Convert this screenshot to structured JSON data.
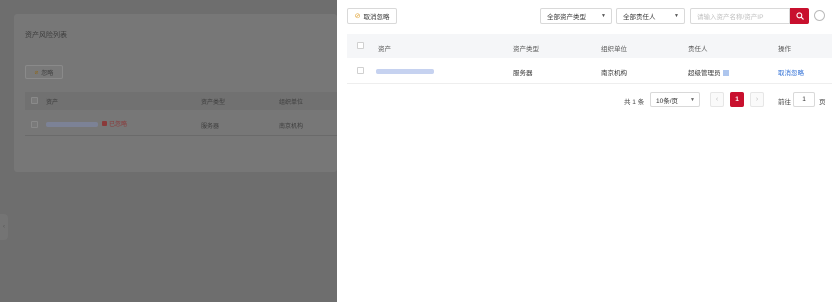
{
  "background": {
    "page_title": "资产风险列表",
    "ignore_button": "忽略",
    "columns": [
      "资产",
      "资产类型",
      "组织单位"
    ],
    "row": {
      "tag": "已忽略",
      "type": "服务器",
      "org": "南京机构"
    }
  },
  "drawer": {
    "toolbar": {
      "cancel_ignore": "取消忽略",
      "asset_type_select": "全部资产类型",
      "owner_select": "全部责任人",
      "search_placeholder": "请输入资产名称/资产IP"
    },
    "table": {
      "columns": [
        "资产",
        "资产类型",
        "组织单位",
        "责任人",
        "操作"
      ],
      "rows": [
        {
          "type": "服务器",
          "org": "南京机构",
          "owner": "超级管理员",
          "action": "取消忽略"
        }
      ]
    },
    "pagination": {
      "total": "共 1 条",
      "page_size": "10条/页",
      "current_page": "1",
      "goto_label": "前往",
      "goto_value": "1",
      "page_unit": "页"
    }
  },
  "colors": {
    "primary": "#c8102e",
    "link": "#2f6fd6",
    "overlay": "#6b6b6b"
  }
}
